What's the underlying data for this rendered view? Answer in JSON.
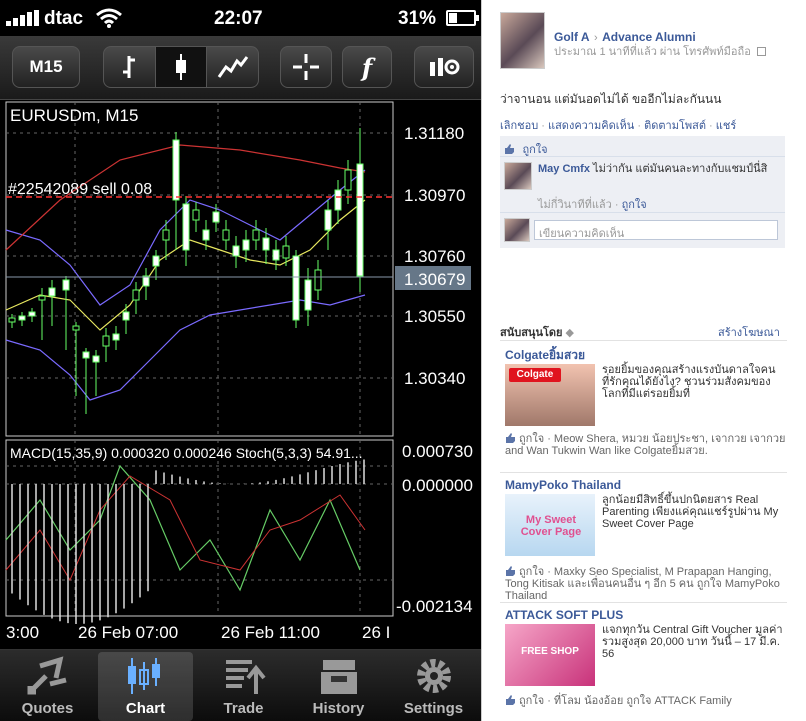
{
  "status_bar": {
    "carrier": "dtac",
    "time": "22:07",
    "battery": "31%",
    "battery_level": 0.31
  },
  "toolbar": {
    "timeframe_label": "M15",
    "buttons": [
      "timeframe-button",
      "bar-chart-icon",
      "candlestick-icon",
      "line-chart-icon",
      "crosshair-icon",
      "indicator-icon",
      "settings-icon"
    ],
    "indicator_glyph": "f"
  },
  "chart": {
    "symbol_label": "EURUSDm, M15",
    "order_label": "#22542089 sell 0.08",
    "current_price": "1.30679",
    "price_ticks": [
      "1.31180",
      "1.30970",
      "1.30760",
      "1.30550",
      "1.30340"
    ],
    "macd_label": "MACD(15,35,9) 0.000320 0.000246 Stoch(5,3,3) 54.91...",
    "macd_ticks": [
      "0.000730",
      "0.000000",
      "-0.002134"
    ],
    "time_ticks": [
      "3:00",
      "26 Feb 07:00",
      "26 Feb 11:00",
      "26 I"
    ],
    "colors": {
      "candle": "#66ff66",
      "line_yellow": "#e8e860",
      "band": "#7a6aff",
      "ma_red": "#cc3333",
      "order_line": "#ff3333",
      "grid": "#666666"
    }
  },
  "tabbar": [
    {
      "name": "quotes",
      "label": "Quotes",
      "icon": "quotes-icon"
    },
    {
      "name": "chart",
      "label": "Chart",
      "icon": "chart-icon",
      "active": true
    },
    {
      "name": "trade",
      "label": "Trade",
      "icon": "trade-icon"
    },
    {
      "name": "history",
      "label": "History",
      "icon": "history-icon"
    },
    {
      "name": "settings",
      "label": "Settings",
      "icon": "settings-gear-icon"
    }
  ],
  "facebook": {
    "post": {
      "author": "Golf A",
      "arrow": "›",
      "group": "Advance Alumni",
      "meta": "ประมาณ 1 นาทีที่แล้ว ผ่าน โทรศัพท์มือถือ",
      "text": "ว่าจานอน แต่มันอดไม่ได้ ขออีกไม่ละกันนน",
      "actions": [
        "เลิกชอบ",
        "แสดงความคิดเห็น",
        "ติดตามโพสต์",
        "แชร์"
      ],
      "likes": "ถูกใจ",
      "comment": {
        "author": "May Cmfx",
        "text": "ไม่ว่ากัน แต่มันคนละทางกับแชมป์นี่สิ",
        "meta": "ไม่กี่วินาทีที่แล้ว",
        "like": "ถูกใจ"
      },
      "comment_placeholder": "เขียนความคิดเห็น"
    },
    "sponsored": {
      "label": "สนับสนุนโดย",
      "create_ad": "สร้างโฆษณา"
    },
    "ads": [
      {
        "title": "Colgateยิ้มสวย",
        "body": "รอยยิ้มของคุณสร้างแรงบันดาลใจคนที่รักคุณได้ยังไง? ชวนร่วมสังคมของโลกที่มีแต่รอยยิ้มที่",
        "like_line": "ถูกใจ · Meow Shera, หมวย น้อยประชา, เจากวย เจากวย and Wan Tukwin Wan like Colgateยิ้มสวย."
      },
      {
        "title": "MamyPoko Thailand",
        "body": "ลูกน้อยมีสิทธิ์ขึ้นปกนิตยสาร Real Parenting เพียงแค่คุณแชร์รูปผ่าน My Sweet Cover Page",
        "img_text": "My Sweet Cover Page",
        "like_line": "ถูกใจ · Maxky Seo Specialist, M Prapapan Hanging, Tong Kitisak และเพื่อนคนอื่น ๆ อีก 5 คน ถูกใจ MamyPoko Thailand"
      },
      {
        "title": "ATTACK SOFT PLUS",
        "body": "แจกทุกวัน Central Gift Voucher มูลค่ารวมสูงสุด 20,000 บาท วันนี้ – 17 มี.ค. 56",
        "img_text": "FREE SHOP",
        "like_line": "ถูกใจ · ที่โลม น้องอ้อย ถูกใจ ATTACK Family"
      }
    ]
  }
}
